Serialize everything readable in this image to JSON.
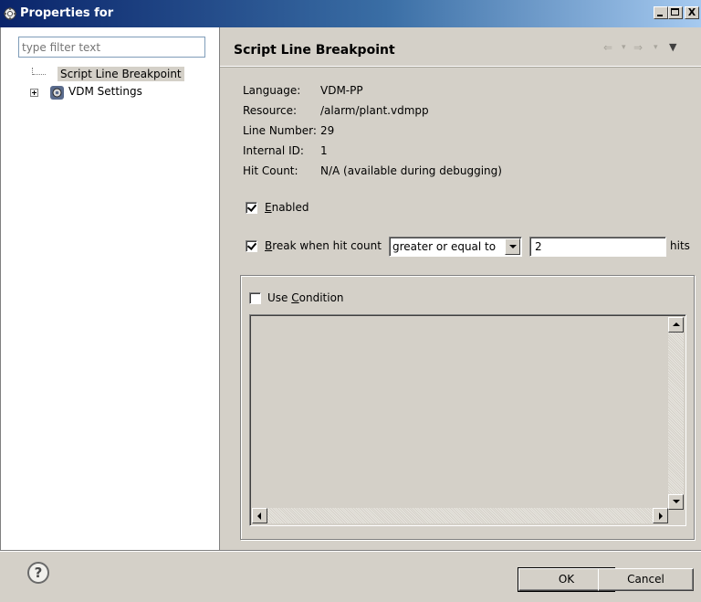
{
  "window": {
    "title": "Properties for",
    "minimize_label": "",
    "maximize_label": "",
    "close_label": "X",
    "icon": "gear-icon"
  },
  "sidebar": {
    "filter_placeholder": "type filter text",
    "filter_value": "",
    "items": [
      {
        "label": "Script Line Breakpoint",
        "selected": true
      },
      {
        "label": "VDM Settings",
        "expandable": true,
        "icon": "vdm-gear-icon"
      }
    ]
  },
  "page": {
    "title": "Script Line Breakpoint",
    "nav": {
      "back_icon": "arrow-left-icon",
      "forward_icon": "arrow-right-icon",
      "menu_icon": "chevron-down-icon"
    },
    "info": [
      {
        "key": "Language:",
        "value": "VDM-PP"
      },
      {
        "key": "Resource:",
        "value": "/alarm/plant.vdmpp"
      },
      {
        "key": "Line Number:",
        "value": "29"
      },
      {
        "key": "Internal ID:",
        "value": "1"
      },
      {
        "key": "Hit Count:",
        "value": "N/A (available during debugging)"
      }
    ],
    "enabled": {
      "mnemonic": "E",
      "rest": "nabled",
      "checked": true
    },
    "break_hit": {
      "mnemonic": "B",
      "rest": "reak when hit count",
      "checked": true
    },
    "hit_condition": "greater or equal to",
    "hit_value": "2",
    "hits_label": "hits",
    "use_condition": {
      "prefix": "Use ",
      "mnemonic": "C",
      "rest": "ondition",
      "checked": false
    }
  },
  "footer": {
    "help_label": "?",
    "ok_label": "OK",
    "cancel_label": "Cancel"
  },
  "colors": {
    "titlebar_start": "#0a246a",
    "titlebar_end": "#a6caf0",
    "dialog_bg": "#d4d0c8"
  }
}
